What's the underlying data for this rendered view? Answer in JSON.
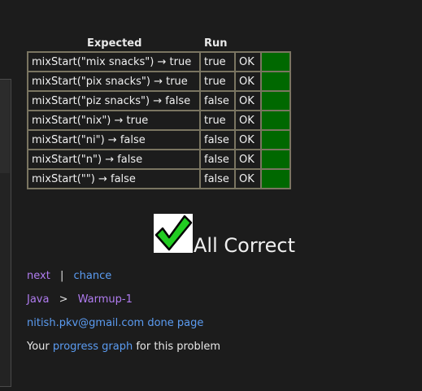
{
  "table": {
    "headers": {
      "expected": "Expected",
      "run": "Run"
    },
    "rows": [
      {
        "expected": "mixStart(\"mix snacks\") → true",
        "run": "true",
        "status": "OK"
      },
      {
        "expected": "mixStart(\"pix snacks\") → true",
        "run": "true",
        "status": "OK"
      },
      {
        "expected": "mixStart(\"piz snacks\") → false",
        "run": "false",
        "status": "OK"
      },
      {
        "expected": "mixStart(\"nix\") → true",
        "run": "true",
        "status": "OK"
      },
      {
        "expected": "mixStart(\"ni\") → false",
        "run": "false",
        "status": "OK"
      },
      {
        "expected": "mixStart(\"n\") → false",
        "run": "false",
        "status": "OK"
      },
      {
        "expected": "mixStart(\"\") → false",
        "run": "false",
        "status": "OK"
      }
    ],
    "pass_color": "#006800"
  },
  "verdict": {
    "text": "All Correct",
    "icon": "check-icon"
  },
  "nav": {
    "next": "next",
    "separator": "|",
    "chance": "chance"
  },
  "breadcrumb": {
    "section": "Java",
    "arrow": ">",
    "page": "Warmup-1"
  },
  "user": {
    "email": "nitish.pkv@gmail.com",
    "done_page": "done page"
  },
  "progress": {
    "prefix": "Your",
    "link": "progress graph",
    "suffix": "for this problem"
  },
  "colors": {
    "background": "#1c1c1c",
    "link_purple": "#b07cf0",
    "link_blue": "#5b9cf2",
    "check_green": "#22cc22"
  }
}
